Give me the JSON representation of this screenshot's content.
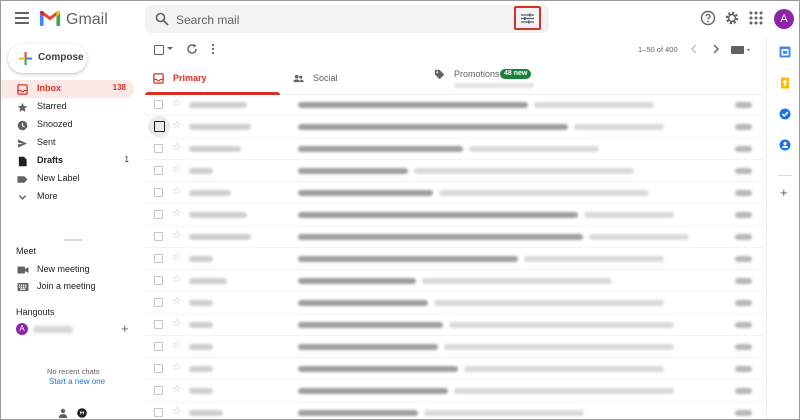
{
  "header": {
    "brand": "Gmail",
    "search_placeholder": "Search mail",
    "avatar_letter": "A"
  },
  "compose": {
    "label": "Compose"
  },
  "nav": {
    "items": [
      {
        "label": "Inbox",
        "count": "138",
        "icon": "inbox-icon",
        "active": true
      },
      {
        "label": "Starred",
        "count": "",
        "icon": "star-icon"
      },
      {
        "label": "Snoozed",
        "count": "",
        "icon": "clock-icon"
      },
      {
        "label": "Sent",
        "count": "",
        "icon": "send-icon"
      },
      {
        "label": "Drafts",
        "count": "1",
        "icon": "draft-icon"
      },
      {
        "label": "New Label",
        "count": "",
        "icon": "label-icon"
      },
      {
        "label": "More",
        "count": "",
        "icon": "chevron-down-icon"
      }
    ]
  },
  "meet": {
    "title": "Meet",
    "items": [
      {
        "label": "New meeting",
        "icon": "video-icon"
      },
      {
        "label": "Join a meeting",
        "icon": "keyboard-icon"
      }
    ]
  },
  "hangouts": {
    "title": "Hangouts",
    "user_initial": "A",
    "no_chats": "No recent chats",
    "start_new": "Start a new one"
  },
  "toolbar": {
    "pager": "1–50 of 400"
  },
  "tabs": [
    {
      "label": "Primary",
      "icon": "inbox-icon",
      "active": true
    },
    {
      "label": "Social",
      "icon": "people-icon"
    },
    {
      "label": "Promotions",
      "icon": "tag-icon",
      "badge": "48 new"
    }
  ],
  "colors": {
    "accent_red": "#d93025",
    "promo_badge": "#188038",
    "active_nav_bg": "#fce8e6",
    "avatar_purple": "#8e24aa"
  },
  "emails": [
    {
      "sender_len": 58,
      "subject_len": 230,
      "snippet_len": 120,
      "focus": false
    },
    {
      "sender_len": 62,
      "subject_len": 270,
      "snippet_len": 90,
      "focus": true
    },
    {
      "sender_len": 52,
      "subject_len": 165,
      "snippet_len": 130,
      "focus": false
    },
    {
      "sender_len": 24,
      "subject_len": 110,
      "snippet_len": 220,
      "focus": false
    },
    {
      "sender_len": 42,
      "subject_len": 135,
      "snippet_len": 210,
      "focus": false
    },
    {
      "sender_len": 58,
      "subject_len": 280,
      "snippet_len": 90,
      "focus": false
    },
    {
      "sender_len": 62,
      "subject_len": 285,
      "snippet_len": 100,
      "focus": false
    },
    {
      "sender_len": 24,
      "subject_len": 220,
      "snippet_len": 140,
      "focus": false
    },
    {
      "sender_len": 38,
      "subject_len": 118,
      "snippet_len": 190,
      "focus": false
    },
    {
      "sender_len": 24,
      "subject_len": 130,
      "snippet_len": 230,
      "focus": false
    },
    {
      "sender_len": 24,
      "subject_len": 145,
      "snippet_len": 225,
      "focus": false
    },
    {
      "sender_len": 24,
      "subject_len": 140,
      "snippet_len": 230,
      "focus": false
    },
    {
      "sender_len": 24,
      "subject_len": 160,
      "snippet_len": 200,
      "focus": false
    },
    {
      "sender_len": 24,
      "subject_len": 150,
      "snippet_len": 220,
      "focus": false
    },
    {
      "sender_len": 34,
      "subject_len": 120,
      "snippet_len": 160,
      "focus": false
    }
  ]
}
